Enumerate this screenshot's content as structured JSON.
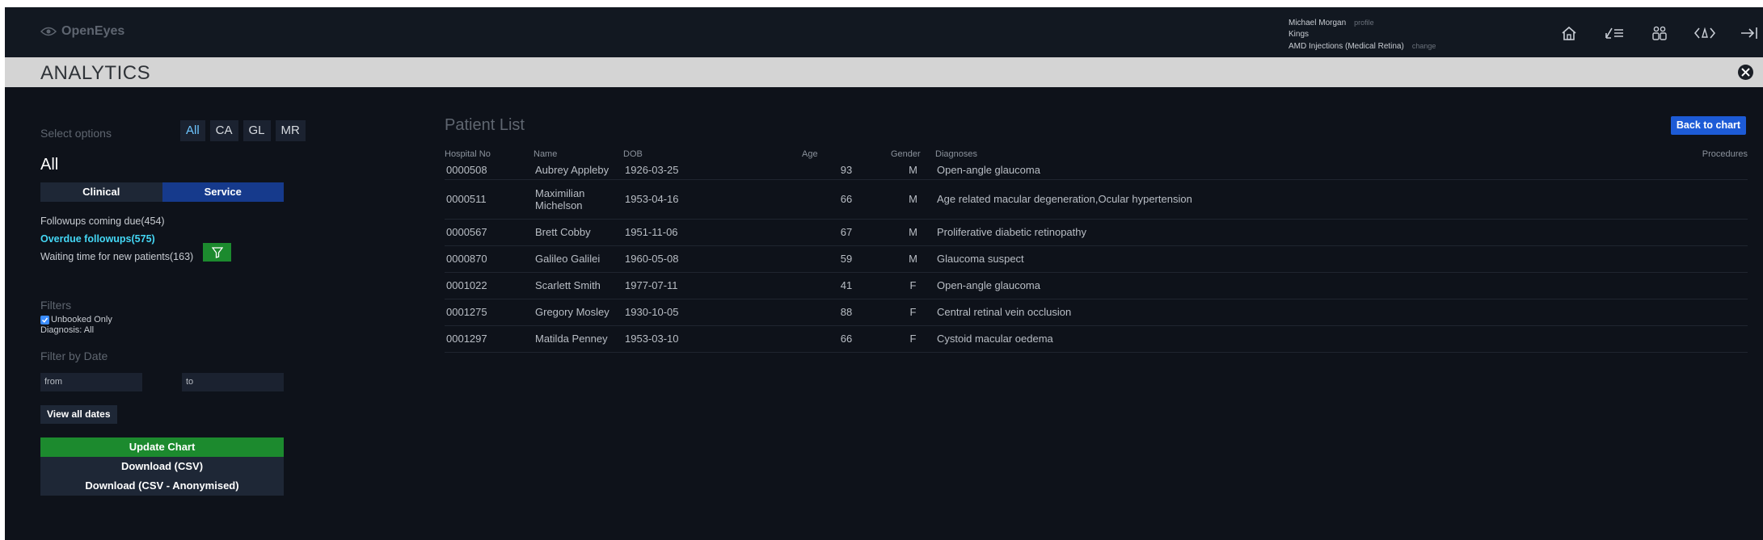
{
  "header": {
    "logo_text": "OpenEyes",
    "user_name": "Michael Morgan",
    "profile_link": "profile",
    "site": "Kings",
    "firm": "AMD Injections (Medical Retina)",
    "change_link": "change",
    "icons": [
      "home-icon",
      "worklist-icon",
      "patients-icon",
      "code-icon",
      "logout-icon"
    ]
  },
  "page": {
    "title": "ANALYTICS"
  },
  "sidebar": {
    "select_options_label": "Select options",
    "specialty_tabs": [
      {
        "label": "All",
        "active": true
      },
      {
        "label": "CA",
        "active": false
      },
      {
        "label": "GL",
        "active": false
      },
      {
        "label": "MR",
        "active": false
      }
    ],
    "specialty_heading": "All",
    "mode_tabs": {
      "clinical": "Clinical",
      "service": "Service"
    },
    "reports": [
      {
        "label": "Followups coming due(454)",
        "active": false
      },
      {
        "label": "Overdue followups(575)",
        "active": true
      },
      {
        "label": "Waiting time for new patients(163)",
        "active": false
      }
    ],
    "filters_label": "Filters",
    "unbooked_label": "Unbooked Only",
    "diagnosis_label": "Diagnosis: All",
    "filter_by_date_label": "Filter by Date",
    "date_from_placeholder": "from",
    "date_to_placeholder": "to",
    "view_all_dates": "View all dates",
    "update_chart": "Update Chart",
    "download_csv": "Download (CSV)",
    "download_csv_anon": "Download (CSV - Anonymised)"
  },
  "main": {
    "title": "Patient List",
    "back_button": "Back to chart",
    "columns": {
      "hospital_no": "Hospital No",
      "name": "Name",
      "dob": "DOB",
      "age": "Age",
      "gender": "Gender",
      "diagnoses": "Diagnoses",
      "procedures": "Procedures"
    },
    "rows": [
      {
        "hospital_no": "0000508",
        "name": "Aubrey Appleby",
        "dob": "1926-03-25",
        "age": "93",
        "gender": "M",
        "diagnoses": "Open-angle glaucoma"
      },
      {
        "hospital_no": "0000511",
        "name": "Maximilian Michelson",
        "dob": "1953-04-16",
        "age": "66",
        "gender": "M",
        "diagnoses": "Age related macular degeneration,Ocular hypertension"
      },
      {
        "hospital_no": "0000567",
        "name": "Brett Cobby",
        "dob": "1951-11-06",
        "age": "67",
        "gender": "M",
        "diagnoses": "Proliferative diabetic retinopathy"
      },
      {
        "hospital_no": "0000870",
        "name": "Galileo Galilei",
        "dob": "1960-05-08",
        "age": "59",
        "gender": "M",
        "diagnoses": "Glaucoma suspect"
      },
      {
        "hospital_no": "0001022",
        "name": "Scarlett Smith",
        "dob": "1977-07-11",
        "age": "41",
        "gender": "F",
        "diagnoses": "Open-angle glaucoma"
      },
      {
        "hospital_no": "0001275",
        "name": "Gregory Mosley",
        "dob": "1930-10-05",
        "age": "88",
        "gender": "F",
        "diagnoses": "Central retinal vein occlusion"
      },
      {
        "hospital_no": "0001297",
        "name": "Matilda Penney",
        "dob": "1953-03-10",
        "age": "66",
        "gender": "F",
        "diagnoses": "Cystoid macular oedema"
      }
    ]
  },
  "colors": {
    "background": "#0e121a",
    "header": "#121821",
    "titlebar": "#d4d4d4",
    "accent_green": "#1c8a2e",
    "accent_blue": "#1d5bd6",
    "service_blue": "#163a8c",
    "active_report": "#44d7f5"
  }
}
